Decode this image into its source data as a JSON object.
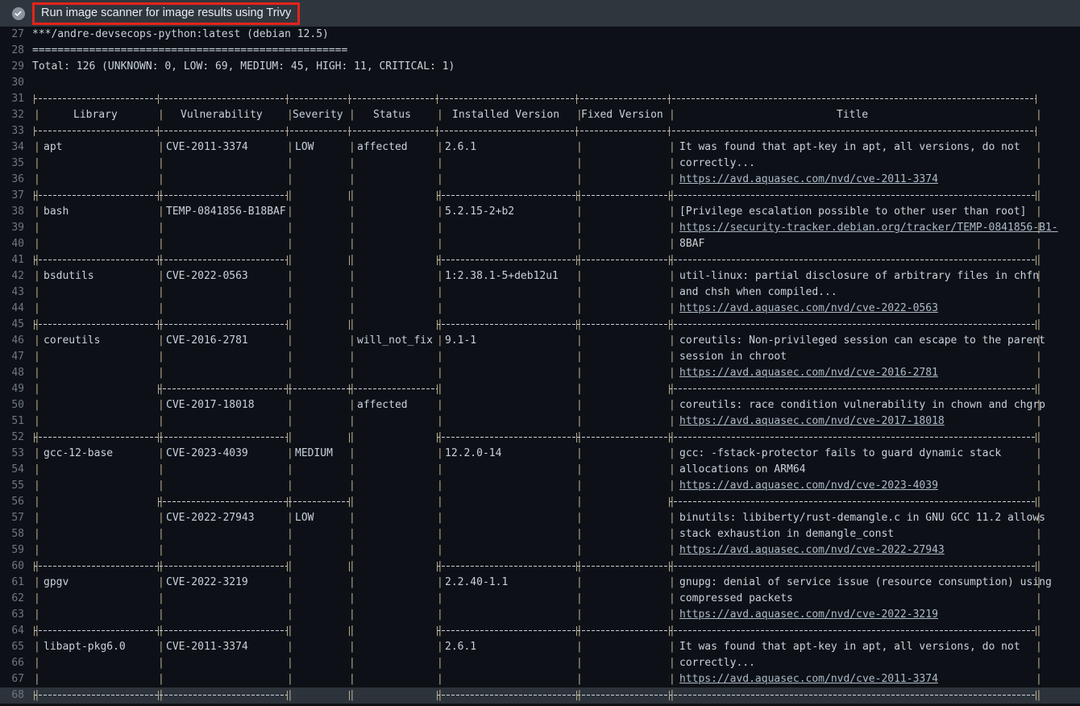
{
  "header": {
    "status_icon": "check-circle-icon",
    "title": "Run image scanner for image results using Trivy",
    "highlight_color": "#e5231b",
    "bar_color": "#30363d"
  },
  "terminal": {
    "background": "#0d1117",
    "foreground": "#c9d1d9",
    "line_number_color": "#6e7681",
    "link_color": "#adbac7",
    "border_color": "#b5a98c",
    "highlight_line": 68,
    "first_line_number": 27,
    "last_line_number": 68
  },
  "report": {
    "image": "***/andre-devsecops-python:latest (debian 12.5)",
    "divider": "==================================================",
    "total_line": "Total: 126 (UNKNOWN: 0, LOW: 69, MEDIUM: 45, HIGH: 11, CRITICAL: 1)",
    "totals": {
      "total": 126,
      "unknown": 0,
      "low": 69,
      "medium": 45,
      "high": 11,
      "critical": 1
    }
  },
  "table": {
    "columns": [
      "Library",
      "Vulnerability",
      "Severity",
      "Status",
      "Installed Version",
      "Fixed Version",
      "Title"
    ],
    "rows": [
      {
        "line_start": 34,
        "library": "apt",
        "vulnerability": "CVE-2011-3374",
        "severity": "LOW",
        "status": "affected",
        "installed_version": "2.6.1",
        "fixed_version": "",
        "title_lines": [
          "It was found that apt-key in apt, all versions, do not",
          "correctly..."
        ],
        "link": "https://avd.aquasec.com/nvd/cve-2011-3374",
        "link_tail": ""
      },
      {
        "line_start": 38,
        "library": "bash",
        "vulnerability": "TEMP-0841856-B18BAF",
        "severity": "",
        "status": "",
        "installed_version": "5.2.15-2+b2",
        "fixed_version": "",
        "title_lines": [
          "[Privilege escalation possible to other user than root]"
        ],
        "link": "https://security-tracker.debian.org/tracker/TEMP-0841856-B1-",
        "link_tail": "8BAF"
      },
      {
        "line_start": 42,
        "library": "bsdutils",
        "vulnerability": "CVE-2022-0563",
        "severity": "",
        "status": "",
        "installed_version": "1:2.38.1-5+deb12u1",
        "fixed_version": "",
        "title_lines": [
          "util-linux: partial disclosure of arbitrary files in chfn",
          "and chsh when compiled..."
        ],
        "link": "https://avd.aquasec.com/nvd/cve-2022-0563",
        "link_tail": ""
      },
      {
        "line_start": 46,
        "library": "coreutils",
        "vulnerability": "CVE-2016-2781",
        "severity": "",
        "status": "will_not_fix",
        "installed_version": "9.1-1",
        "fixed_version": "",
        "title_lines": [
          "coreutils: Non-privileged session can escape to the parent",
          "session in chroot"
        ],
        "link": "https://avd.aquasec.com/nvd/cve-2016-2781",
        "link_tail": ""
      },
      {
        "line_start": 50,
        "library": "",
        "vulnerability": "CVE-2017-18018",
        "severity": "",
        "status": "affected",
        "installed_version": "",
        "fixed_version": "",
        "title_lines": [
          "coreutils: race condition vulnerability in chown and chgrp"
        ],
        "link": "https://avd.aquasec.com/nvd/cve-2017-18018",
        "link_tail": ""
      },
      {
        "line_start": 53,
        "library": "gcc-12-base",
        "vulnerability": "CVE-2023-4039",
        "severity": "MEDIUM",
        "status": "",
        "installed_version": "12.2.0-14",
        "fixed_version": "",
        "title_lines": [
          "gcc: -fstack-protector fails to guard dynamic stack",
          "allocations on ARM64"
        ],
        "link": "https://avd.aquasec.com/nvd/cve-2023-4039",
        "link_tail": ""
      },
      {
        "line_start": 57,
        "library": "",
        "vulnerability": "CVE-2022-27943",
        "severity": "LOW",
        "status": "",
        "installed_version": "",
        "fixed_version": "",
        "title_lines": [
          "binutils: libiberty/rust-demangle.c in GNU GCC 11.2 allows",
          "stack exhaustion in demangle_const"
        ],
        "link": "https://avd.aquasec.com/nvd/cve-2022-27943",
        "link_tail": ""
      },
      {
        "line_start": 61,
        "library": "gpgv",
        "vulnerability": "CVE-2022-3219",
        "severity": "",
        "status": "",
        "installed_version": "2.2.40-1.1",
        "fixed_version": "",
        "title_lines": [
          "gnupg: denial of service issue (resource consumption) using",
          "compressed packets"
        ],
        "link": "https://avd.aquasec.com/nvd/cve-2022-3219",
        "link_tail": ""
      },
      {
        "line_start": 65,
        "library": "libapt-pkg6.0",
        "vulnerability": "CVE-2011-3374",
        "severity": "",
        "status": "",
        "installed_version": "2.6.1",
        "fixed_version": "",
        "title_lines": [
          "It was found that apt-key in apt, all versions, do not",
          "correctly..."
        ],
        "link": "https://avd.aquasec.com/nvd/cve-2011-3374",
        "link_tail": ""
      }
    ]
  }
}
